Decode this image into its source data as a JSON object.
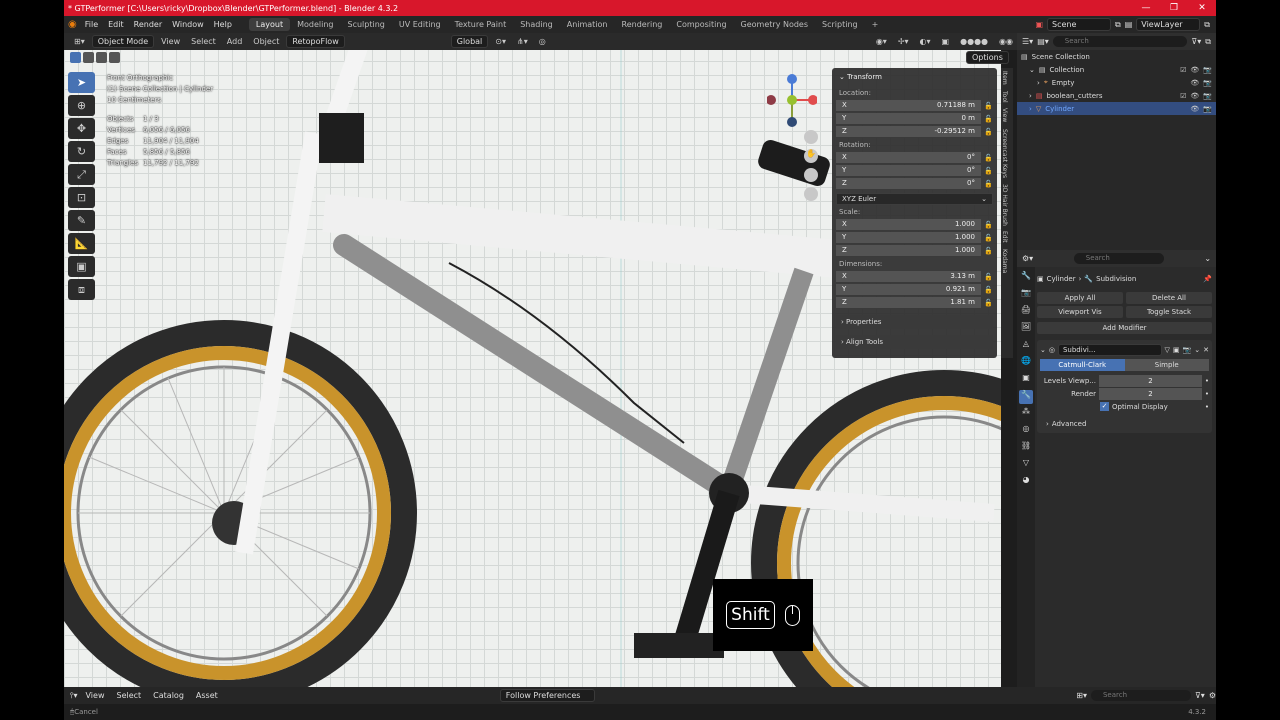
{
  "titlebar": {
    "title": "* GTPerformer [C:\\Users\\ricky\\Dropbox\\Blender\\GTPerformer.blend] - Blender 4.3.2"
  },
  "menu": [
    "File",
    "Edit",
    "Render",
    "Window",
    "Help"
  ],
  "workspaces": [
    "Layout",
    "Modeling",
    "Sculpting",
    "UV Editing",
    "Texture Paint",
    "Shading",
    "Animation",
    "Rendering",
    "Compositing",
    "Geometry Nodes",
    "Scripting"
  ],
  "active_workspace": "Layout",
  "scene": {
    "name": "Scene",
    "view_layer": "ViewLayer"
  },
  "viewport_header": {
    "mode": "Object Mode",
    "items": [
      "View",
      "Select",
      "Add",
      "Object"
    ],
    "addon": "RetopoFlow",
    "orientation": "Global"
  },
  "overlay": {
    "view_name": "Front Orthographic",
    "collection": "(1) Scene Collection | Cylinder",
    "units": "10 Centimeters",
    "stats": [
      {
        "k": "Objects",
        "v": "1 / 3"
      },
      {
        "k": "Vertices",
        "v": "6,056 / 6,056"
      },
      {
        "k": "Edges",
        "v": "11,904 / 11,904"
      },
      {
        "k": "Faces",
        "v": "5,856 / 5,856"
      },
      {
        "k": "Triangles",
        "v": "11,792 / 11,792"
      }
    ]
  },
  "npanel": {
    "options_label": "Options",
    "transform_label": "Transform",
    "location_label": "Location:",
    "location": [
      {
        "axis": "X",
        "val": "0.71188 m"
      },
      {
        "axis": "Y",
        "val": "0 m"
      },
      {
        "axis": "Z",
        "val": "-0.29512 m"
      }
    ],
    "rotation_label": "Rotation:",
    "rotation": [
      {
        "axis": "X",
        "val": "0°"
      },
      {
        "axis": "Y",
        "val": "0°"
      },
      {
        "axis": "Z",
        "val": "0°"
      }
    ],
    "rotation_mode": "XYZ Euler",
    "scale_label": "Scale:",
    "scale": [
      {
        "axis": "X",
        "val": "1.000"
      },
      {
        "axis": "Y",
        "val": "1.000"
      },
      {
        "axis": "Z",
        "val": "1.000"
      }
    ],
    "dimensions_label": "Dimensions:",
    "dimensions": [
      {
        "axis": "X",
        "val": "3.13 m"
      },
      {
        "axis": "Y",
        "val": "0.921 m"
      },
      {
        "axis": "Z",
        "val": "1.81 m"
      }
    ],
    "properties_label": "Properties",
    "align_label": "Align Tools",
    "tabs": [
      "Item",
      "Tool",
      "View",
      "Screencast Keys",
      "3D Hair Brush",
      "Edit",
      "Kodama"
    ]
  },
  "outliner": {
    "search_placeholder": "Search",
    "rows": [
      {
        "label": "Scene Collection",
        "depth": 0
      },
      {
        "label": "Collection",
        "depth": 1
      },
      {
        "label": "Empty",
        "depth": 2
      },
      {
        "label": "boolean_cutters",
        "depth": 1
      },
      {
        "label": "Cylinder",
        "depth": 1
      }
    ]
  },
  "properties": {
    "search_placeholder": "Search",
    "breadcrumb_object": "Cylinder",
    "breadcrumb_modifier": "Subdivision",
    "apply_all": "Apply All",
    "delete_all": "Delete All",
    "viewport_vis": "Viewport Vis",
    "toggle_stack": "Toggle Stack",
    "add_modifier": "Add Modifier",
    "modifier_name": "Subdivi...",
    "mode_a": "Catmull-Clark",
    "mode_b": "Simple",
    "levels_label": "Levels Viewp...",
    "levels_val": "2",
    "render_label": "Render",
    "render_val": "2",
    "optimal_display": "Optimal Display",
    "advanced": "Advanced"
  },
  "bottombar": {
    "items": [
      "View",
      "Select",
      "Catalog",
      "Asset"
    ],
    "follow": "Follow Preferences",
    "search_placeholder": "Search"
  },
  "statusbar": {
    "left": "Cancel",
    "version": "4.3.2"
  },
  "keycast": {
    "key": "Shift"
  }
}
